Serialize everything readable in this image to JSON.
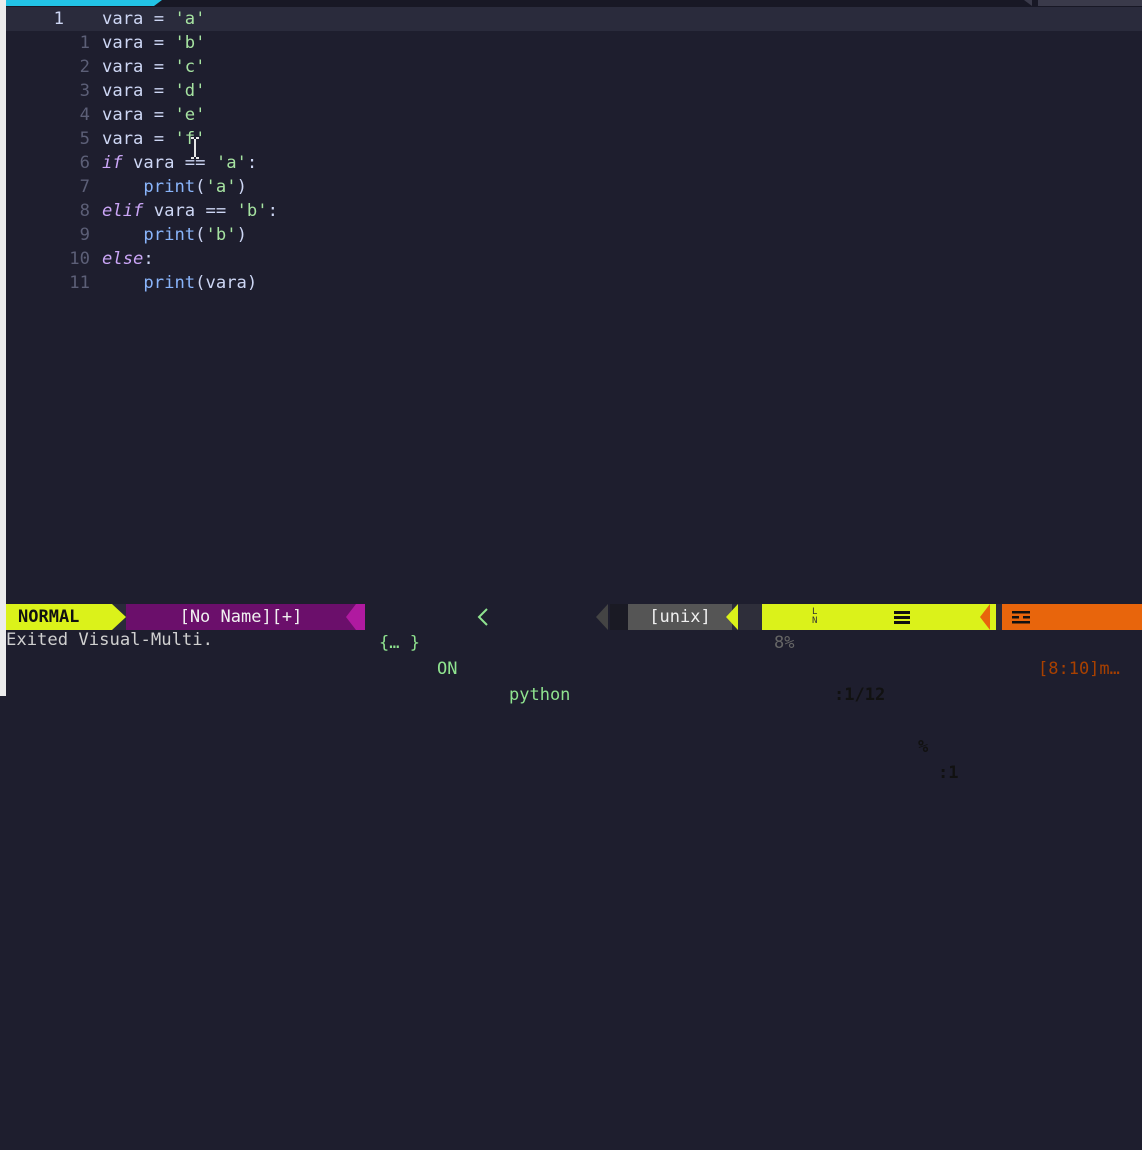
{
  "editor": {
    "current_line_number": "1",
    "lines": [
      {
        "num": "1",
        "tokens": [
          {
            "t": "id",
            "v": "vara = "
          },
          {
            "t": "str",
            "v": "'a'"
          }
        ]
      },
      {
        "num": "1",
        "tokens": [
          {
            "t": "id",
            "v": "vara = "
          },
          {
            "t": "str",
            "v": "'b'"
          }
        ]
      },
      {
        "num": "2",
        "tokens": [
          {
            "t": "id",
            "v": "vara = "
          },
          {
            "t": "str",
            "v": "'c'"
          }
        ]
      },
      {
        "num": "3",
        "tokens": [
          {
            "t": "id",
            "v": "vara = "
          },
          {
            "t": "str",
            "v": "'d'"
          }
        ]
      },
      {
        "num": "4",
        "tokens": [
          {
            "t": "id",
            "v": "vara = "
          },
          {
            "t": "str",
            "v": "'e'"
          }
        ]
      },
      {
        "num": "5",
        "tokens": [
          {
            "t": "id",
            "v": "vara = "
          },
          {
            "t": "str",
            "v": "'f'"
          }
        ]
      },
      {
        "num": "6",
        "tokens": [
          {
            "t": "kw",
            "v": "if"
          },
          {
            "t": "id",
            "v": " vara == "
          },
          {
            "t": "str",
            "v": "'a'"
          },
          {
            "t": "id",
            "v": ":"
          }
        ]
      },
      {
        "num": "7",
        "tokens": [
          {
            "t": "id",
            "v": "    "
          },
          {
            "t": "fn",
            "v": "print"
          },
          {
            "t": "id",
            "v": "("
          },
          {
            "t": "str",
            "v": "'a'"
          },
          {
            "t": "id",
            "v": ")"
          }
        ]
      },
      {
        "num": "8",
        "tokens": [
          {
            "t": "kw",
            "v": "elif"
          },
          {
            "t": "id",
            "v": " vara == "
          },
          {
            "t": "str",
            "v": "'b'"
          },
          {
            "t": "id",
            "v": ":"
          }
        ]
      },
      {
        "num": "9",
        "tokens": [
          {
            "t": "id",
            "v": "    "
          },
          {
            "t": "fn",
            "v": "print"
          },
          {
            "t": "id",
            "v": "("
          },
          {
            "t": "str",
            "v": "'b'"
          },
          {
            "t": "id",
            "v": ")"
          }
        ]
      },
      {
        "num": "10",
        "tokens": [
          {
            "t": "kw",
            "v": "else"
          },
          {
            "t": "id",
            "v": ":"
          }
        ]
      },
      {
        "num": "11",
        "tokens": [
          {
            "t": "id",
            "v": "    "
          },
          {
            "t": "fn",
            "v": "print"
          },
          {
            "t": "id",
            "v": "(vara)"
          }
        ]
      }
    ]
  },
  "statusline": {
    "mode": "NORMAL",
    "filename": "[No Name][+]",
    "brackets": "{… }",
    "toggle": "ON",
    "filetype": "python",
    "fileformat": "[unix]",
    "percent": "8%",
    "ln_glyph": "L\nN",
    "line_pos": ":1/12",
    "percent_sign": "%",
    "column": ":1",
    "warning": "[8:10]m…"
  },
  "cmdline": {
    "message": "Exited Visual-Multi."
  },
  "colors": {
    "background": "#1e1e2e",
    "mode_bg": "#dbf21a",
    "file_bg": "#6b0f6b",
    "warn_bg": "#e8650c",
    "tab_accent": "#22c3e6"
  }
}
